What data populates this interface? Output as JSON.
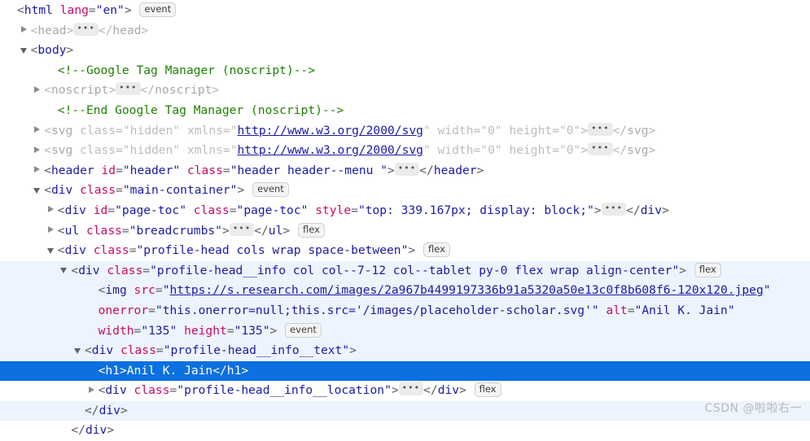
{
  "panel": {
    "name": "elements-dom-tree",
    "background": "#ffffff",
    "selection_color": "#0b70e0",
    "ancestor_highlight_color": "#edf4fd"
  },
  "badges": {
    "event": "event",
    "flex": "flex"
  },
  "ellipsis": "•••",
  "lines": [
    {
      "id": "line-html-open",
      "indent": 0,
      "twisty": "none",
      "state": "normal",
      "tokens": [
        {
          "t": "punct",
          "s": "<"
        },
        {
          "t": "tag",
          "s": "html"
        },
        {
          "t": "sp",
          "s": " "
        },
        {
          "t": "attr",
          "s": "lang"
        },
        {
          "t": "punct",
          "s": "="
        },
        {
          "t": "val",
          "s": "\"en\""
        },
        {
          "t": "punct",
          "s": ">"
        },
        {
          "t": "sp",
          "s": " "
        },
        {
          "t": "badge",
          "s": "event"
        }
      ]
    },
    {
      "id": "line-head",
      "indent": 1,
      "twisty": "closed",
      "state": "normal",
      "tokens": [
        {
          "t": "mpunct",
          "s": "<"
        },
        {
          "t": "mtag",
          "s": "head"
        },
        {
          "t": "mpunct",
          "s": ">"
        },
        {
          "t": "ellipsis",
          "s": "•••"
        },
        {
          "t": "mpunct",
          "s": "</"
        },
        {
          "t": "mtag",
          "s": "head"
        },
        {
          "t": "mpunct",
          "s": ">"
        }
      ]
    },
    {
      "id": "line-body-open",
      "indent": 1,
      "twisty": "open",
      "state": "normal",
      "tokens": [
        {
          "t": "punct",
          "s": "<"
        },
        {
          "t": "tag",
          "s": "body"
        },
        {
          "t": "punct",
          "s": ">"
        }
      ]
    },
    {
      "id": "line-comment-gtm-start",
      "indent": 3,
      "twisty": "none",
      "state": "normal",
      "tokens": [
        {
          "t": "comment",
          "s": "<!--Google Tag Manager (noscript)-->"
        }
      ]
    },
    {
      "id": "line-noscript",
      "indent": 2,
      "twisty": "closed",
      "state": "normal",
      "tokens": [
        {
          "t": "mpunct",
          "s": "<"
        },
        {
          "t": "mtag",
          "s": "noscript"
        },
        {
          "t": "mpunct",
          "s": ">"
        },
        {
          "t": "ellipsis",
          "s": "•••"
        },
        {
          "t": "mpunct",
          "s": "</"
        },
        {
          "t": "mtag",
          "s": "noscript"
        },
        {
          "t": "mpunct",
          "s": ">"
        }
      ]
    },
    {
      "id": "line-comment-gtm-end",
      "indent": 3,
      "twisty": "none",
      "state": "normal",
      "tokens": [
        {
          "t": "comment",
          "s": "<!--End Google Tag Manager (noscript)-->"
        }
      ]
    },
    {
      "id": "line-svg-hidden-1",
      "indent": 2,
      "twisty": "closed",
      "state": "normal",
      "tokens": [
        {
          "t": "mpunct",
          "s": "<"
        },
        {
          "t": "mtag",
          "s": "svg"
        },
        {
          "t": "sp",
          "s": " "
        },
        {
          "t": "mattr",
          "s": "class"
        },
        {
          "t": "mpunct",
          "s": "="
        },
        {
          "t": "mval",
          "s": "\"hidden\""
        },
        {
          "t": "sp",
          "s": " "
        },
        {
          "t": "mattr",
          "s": "xmlns"
        },
        {
          "t": "mpunct",
          "s": "="
        },
        {
          "t": "mval",
          "s": "\""
        },
        {
          "t": "url",
          "s": "http://www.w3.org/2000/svg"
        },
        {
          "t": "mval",
          "s": "\""
        },
        {
          "t": "sp",
          "s": " "
        },
        {
          "t": "mattr",
          "s": "width"
        },
        {
          "t": "mpunct",
          "s": "="
        },
        {
          "t": "mval",
          "s": "\"0\""
        },
        {
          "t": "sp",
          "s": " "
        },
        {
          "t": "mattr",
          "s": "height"
        },
        {
          "t": "mpunct",
          "s": "="
        },
        {
          "t": "mval",
          "s": "\"0\""
        },
        {
          "t": "mpunct",
          "s": ">"
        },
        {
          "t": "ellipsis",
          "s": "•••"
        },
        {
          "t": "mpunct",
          "s": "</"
        },
        {
          "t": "mtag",
          "s": "svg"
        },
        {
          "t": "mpunct",
          "s": ">"
        }
      ]
    },
    {
      "id": "line-svg-hidden-2",
      "indent": 2,
      "twisty": "closed",
      "state": "normal",
      "tokens": [
        {
          "t": "mpunct",
          "s": "<"
        },
        {
          "t": "mtag",
          "s": "svg"
        },
        {
          "t": "sp",
          "s": " "
        },
        {
          "t": "mattr",
          "s": "class"
        },
        {
          "t": "mpunct",
          "s": "="
        },
        {
          "t": "mval",
          "s": "\"hidden\""
        },
        {
          "t": "sp",
          "s": " "
        },
        {
          "t": "mattr",
          "s": "xmlns"
        },
        {
          "t": "mpunct",
          "s": "="
        },
        {
          "t": "mval",
          "s": "\""
        },
        {
          "t": "url",
          "s": "http://www.w3.org/2000/svg"
        },
        {
          "t": "mval",
          "s": "\""
        },
        {
          "t": "sp",
          "s": " "
        },
        {
          "t": "mattr",
          "s": "width"
        },
        {
          "t": "mpunct",
          "s": "="
        },
        {
          "t": "mval",
          "s": "\"0\""
        },
        {
          "t": "sp",
          "s": " "
        },
        {
          "t": "mattr",
          "s": "height"
        },
        {
          "t": "mpunct",
          "s": "="
        },
        {
          "t": "mval",
          "s": "\"0\""
        },
        {
          "t": "mpunct",
          "s": ">"
        },
        {
          "t": "ellipsis",
          "s": "•••"
        },
        {
          "t": "mpunct",
          "s": "</"
        },
        {
          "t": "mtag",
          "s": "svg"
        },
        {
          "t": "mpunct",
          "s": ">"
        }
      ]
    },
    {
      "id": "line-header",
      "indent": 2,
      "twisty": "closed",
      "state": "normal",
      "tokens": [
        {
          "t": "punct",
          "s": "<"
        },
        {
          "t": "tag",
          "s": "header"
        },
        {
          "t": "sp",
          "s": " "
        },
        {
          "t": "attr",
          "s": "id"
        },
        {
          "t": "punct",
          "s": "="
        },
        {
          "t": "val",
          "s": "\"header\""
        },
        {
          "t": "sp",
          "s": " "
        },
        {
          "t": "attr",
          "s": "class"
        },
        {
          "t": "punct",
          "s": "="
        },
        {
          "t": "val",
          "s": "\"header header--menu \""
        },
        {
          "t": "punct",
          "s": ">"
        },
        {
          "t": "ellipsis",
          "s": "•••"
        },
        {
          "t": "punct",
          "s": "</"
        },
        {
          "t": "tag",
          "s": "header"
        },
        {
          "t": "punct",
          "s": ">"
        }
      ]
    },
    {
      "id": "line-main-container",
      "indent": 2,
      "twisty": "open",
      "state": "normal",
      "tokens": [
        {
          "t": "punct",
          "s": "<"
        },
        {
          "t": "tag",
          "s": "div"
        },
        {
          "t": "sp",
          "s": " "
        },
        {
          "t": "attr",
          "s": "class"
        },
        {
          "t": "punct",
          "s": "="
        },
        {
          "t": "val",
          "s": "\"main-container\""
        },
        {
          "t": "punct",
          "s": ">"
        },
        {
          "t": "sp",
          "s": " "
        },
        {
          "t": "badge",
          "s": "event"
        }
      ]
    },
    {
      "id": "line-page-toc",
      "indent": 3,
      "twisty": "closed",
      "state": "normal",
      "tokens": [
        {
          "t": "punct",
          "s": "<"
        },
        {
          "t": "tag",
          "s": "div"
        },
        {
          "t": "sp",
          "s": " "
        },
        {
          "t": "attr",
          "s": "id"
        },
        {
          "t": "punct",
          "s": "="
        },
        {
          "t": "val",
          "s": "\"page-toc\""
        },
        {
          "t": "sp",
          "s": " "
        },
        {
          "t": "attr",
          "s": "class"
        },
        {
          "t": "punct",
          "s": "="
        },
        {
          "t": "val",
          "s": "\"page-toc\""
        },
        {
          "t": "sp",
          "s": " "
        },
        {
          "t": "attr",
          "s": "style"
        },
        {
          "t": "punct",
          "s": "="
        },
        {
          "t": "val",
          "s": "\"top: 339.167px; display: block;\""
        },
        {
          "t": "punct",
          "s": ">"
        },
        {
          "t": "ellipsis",
          "s": "•••"
        },
        {
          "t": "punct",
          "s": "</"
        },
        {
          "t": "tag",
          "s": "div"
        },
        {
          "t": "punct",
          "s": ">"
        }
      ]
    },
    {
      "id": "line-breadcrumbs",
      "indent": 3,
      "twisty": "closed",
      "state": "normal",
      "tokens": [
        {
          "t": "punct",
          "s": "<"
        },
        {
          "t": "tag",
          "s": "ul"
        },
        {
          "t": "sp",
          "s": " "
        },
        {
          "t": "attr",
          "s": "class"
        },
        {
          "t": "punct",
          "s": "="
        },
        {
          "t": "val",
          "s": "\"breadcrumbs\""
        },
        {
          "t": "punct",
          "s": ">"
        },
        {
          "t": "ellipsis",
          "s": "•••"
        },
        {
          "t": "punct",
          "s": "</"
        },
        {
          "t": "tag",
          "s": "ul"
        },
        {
          "t": "punct",
          "s": ">"
        },
        {
          "t": "sp",
          "s": " "
        },
        {
          "t": "badge",
          "s": "flex"
        }
      ]
    },
    {
      "id": "line-profile-head",
      "indent": 3,
      "twisty": "open",
      "state": "normal",
      "tokens": [
        {
          "t": "punct",
          "s": "<"
        },
        {
          "t": "tag",
          "s": "div"
        },
        {
          "t": "sp",
          "s": " "
        },
        {
          "t": "attr",
          "s": "class"
        },
        {
          "t": "punct",
          "s": "="
        },
        {
          "t": "val",
          "s": "\"profile-head cols wrap space-between\""
        },
        {
          "t": "punct",
          "s": ">"
        },
        {
          "t": "sp",
          "s": " "
        },
        {
          "t": "badge",
          "s": "flex"
        }
      ]
    },
    {
      "id": "line-profile-head-info",
      "indent": 4,
      "twisty": "open",
      "state": "ancestor",
      "tokens": [
        {
          "t": "punct",
          "s": "<"
        },
        {
          "t": "tag",
          "s": "div"
        },
        {
          "t": "sp",
          "s": " "
        },
        {
          "t": "attr",
          "s": "class"
        },
        {
          "t": "punct",
          "s": "="
        },
        {
          "t": "val",
          "s": "\"profile-head__info col col--7-12 col--tablet py-0 flex wrap align-center\""
        },
        {
          "t": "punct",
          "s": ">"
        },
        {
          "t": "sp",
          "s": " "
        },
        {
          "t": "badge",
          "s": "flex"
        }
      ]
    },
    {
      "id": "line-img-1",
      "indent": 6,
      "twisty": "none",
      "state": "ancestor",
      "tokens": [
        {
          "t": "punct",
          "s": "<"
        },
        {
          "t": "tag",
          "s": "img"
        },
        {
          "t": "sp",
          "s": " "
        },
        {
          "t": "attr",
          "s": "src"
        },
        {
          "t": "punct",
          "s": "="
        },
        {
          "t": "val",
          "s": "\""
        },
        {
          "t": "url",
          "s": "https://s.research.com/images/2a967b4499197336b91a5320a50e13c0f8b608f6-120x120.jpeg"
        },
        {
          "t": "val",
          "s": "\""
        }
      ]
    },
    {
      "id": "line-img-2",
      "indent": 6,
      "twisty": "none",
      "state": "ancestor",
      "tokens": [
        {
          "t": "attr",
          "s": "onerror"
        },
        {
          "t": "punct",
          "s": "="
        },
        {
          "t": "val",
          "s": "\"this.onerror=null;this.src='/images/placeholder-scholar.svg'\""
        },
        {
          "t": "sp",
          "s": " "
        },
        {
          "t": "attr",
          "s": "alt"
        },
        {
          "t": "punct",
          "s": "="
        },
        {
          "t": "val",
          "s": "\"Anil K. Jain\""
        }
      ]
    },
    {
      "id": "line-img-3",
      "indent": 6,
      "twisty": "none",
      "state": "ancestor",
      "tokens": [
        {
          "t": "attr",
          "s": "width"
        },
        {
          "t": "punct",
          "s": "="
        },
        {
          "t": "val",
          "s": "\"135\""
        },
        {
          "t": "sp",
          "s": " "
        },
        {
          "t": "attr",
          "s": "height"
        },
        {
          "t": "punct",
          "s": "="
        },
        {
          "t": "val",
          "s": "\"135\""
        },
        {
          "t": "punct",
          "s": ">"
        },
        {
          "t": "sp",
          "s": " "
        },
        {
          "t": "badge",
          "s": "event"
        }
      ]
    },
    {
      "id": "line-profile-head-info-text",
      "indent": 5,
      "twisty": "open",
      "state": "ancestor",
      "tokens": [
        {
          "t": "punct",
          "s": "<"
        },
        {
          "t": "tag",
          "s": "div"
        },
        {
          "t": "sp",
          "s": " "
        },
        {
          "t": "attr",
          "s": "class"
        },
        {
          "t": "punct",
          "s": "="
        },
        {
          "t": "val",
          "s": "\"profile-head__info__text\""
        },
        {
          "t": "punct",
          "s": ">"
        }
      ]
    },
    {
      "id": "line-h1-selected",
      "indent": 6,
      "twisty": "none",
      "state": "selected",
      "tokens": [
        {
          "t": "punct",
          "s": "<"
        },
        {
          "t": "tag",
          "s": "h1"
        },
        {
          "t": "punct",
          "s": ">"
        },
        {
          "t": "text",
          "s": "Anil K. Jain"
        },
        {
          "t": "punct",
          "s": "</"
        },
        {
          "t": "tag",
          "s": "h1"
        },
        {
          "t": "punct",
          "s": ">"
        }
      ]
    },
    {
      "id": "line-profile-head-info-location",
      "indent": 6,
      "twisty": "closed",
      "state": "normal",
      "tokens": [
        {
          "t": "punct",
          "s": "<"
        },
        {
          "t": "tag",
          "s": "div"
        },
        {
          "t": "sp",
          "s": " "
        },
        {
          "t": "attr",
          "s": "class"
        },
        {
          "t": "punct",
          "s": "="
        },
        {
          "t": "val",
          "s": "\"profile-head__info__location\""
        },
        {
          "t": "punct",
          "s": ">"
        },
        {
          "t": "ellipsis",
          "s": "•••"
        },
        {
          "t": "punct",
          "s": "</"
        },
        {
          "t": "tag",
          "s": "div"
        },
        {
          "t": "punct",
          "s": ">"
        },
        {
          "t": "sp",
          "s": " "
        },
        {
          "t": "badge",
          "s": "flex"
        }
      ]
    },
    {
      "id": "line-close-div-inner",
      "indent": 5,
      "twisty": "none",
      "state": "ancestor",
      "tokens": [
        {
          "t": "punct",
          "s": "</"
        },
        {
          "t": "tag",
          "s": "div"
        },
        {
          "t": "punct",
          "s": ">"
        }
      ]
    },
    {
      "id": "line-close-div-outer",
      "indent": 4,
      "twisty": "none",
      "state": "normal",
      "tokens": [
        {
          "t": "punct",
          "s": "</"
        },
        {
          "t": "tag",
          "s": "div"
        },
        {
          "t": "punct",
          "s": ">"
        }
      ]
    }
  ],
  "watermark": {
    "text": "CSDN @啦啦右一"
  }
}
